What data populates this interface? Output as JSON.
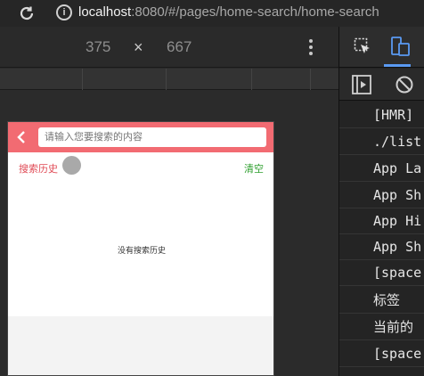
{
  "browser": {
    "url_host": "localhost",
    "url_rest": ":8080/#/pages/home-search/home-search"
  },
  "device_toolbar": {
    "width": "375",
    "separator": "×",
    "height": "667"
  },
  "app": {
    "search_placeholder": "请输入您要搜索的内容",
    "history_title": "搜索历史",
    "clear_label": "清空",
    "empty_message": "没有搜索历史",
    "header_color": "#f26b72"
  },
  "console": {
    "lines": [
      "[HMR]",
      "./list",
      "App La",
      "App Sh",
      "App Hi",
      "App Sh",
      "[space",
      "标签",
      "当前的",
      "[space"
    ]
  }
}
